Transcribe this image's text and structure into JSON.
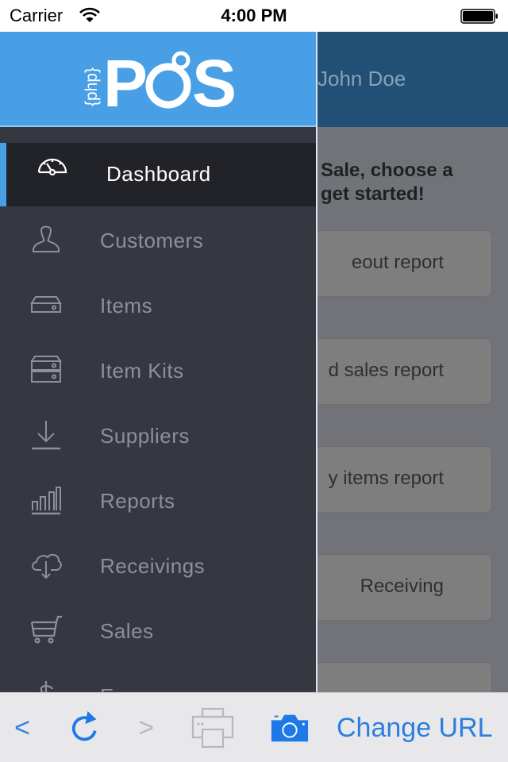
{
  "status_bar": {
    "carrier": "Carrier",
    "time": "4:00 PM",
    "wifi_icon": "wifi-icon",
    "battery_icon": "battery-full-icon"
  },
  "brand": {
    "logo_text_small": "{php}",
    "logo_text_large": "POS",
    "primary_color": "#489fe6",
    "drawer_bg": "#353841",
    "active_bg": "#222328"
  },
  "drawer": {
    "items": [
      {
        "label": "Dashboard",
        "icon": "dashboard-gauge-icon",
        "active": true
      },
      {
        "label": "Customers",
        "icon": "customer-person-icon",
        "active": false
      },
      {
        "label": "Items",
        "icon": "item-box-icon",
        "active": false
      },
      {
        "label": "Item Kits",
        "icon": "item-kits-stack-icon",
        "active": false
      },
      {
        "label": "Suppliers",
        "icon": "download-arrow-icon",
        "active": false
      },
      {
        "label": "Reports",
        "icon": "bar-chart-icon",
        "active": false
      },
      {
        "label": "Receivings",
        "icon": "cloud-download-icon",
        "active": false
      },
      {
        "label": "Sales",
        "icon": "shopping-cart-icon",
        "active": false
      },
      {
        "label": "Expenses",
        "icon": "dollar-icon",
        "active": false
      }
    ]
  },
  "main": {
    "user_name": "John Doe",
    "welcome_line1": "Sale, choose a",
    "welcome_line2": "get started!",
    "cards": [
      {
        "label": "eout report"
      },
      {
        "label": "d sales report"
      },
      {
        "label": "y items report"
      },
      {
        "label": "Receiving"
      },
      {
        "label": ""
      }
    ]
  },
  "toolbar": {
    "back_label": "<",
    "forward_label": ">",
    "reload_icon": "reload-icon",
    "print_icon": "print-icon",
    "camera_icon": "camera-icon",
    "change_url_label": "Change URL",
    "accent_color": "#2b7fe0"
  }
}
